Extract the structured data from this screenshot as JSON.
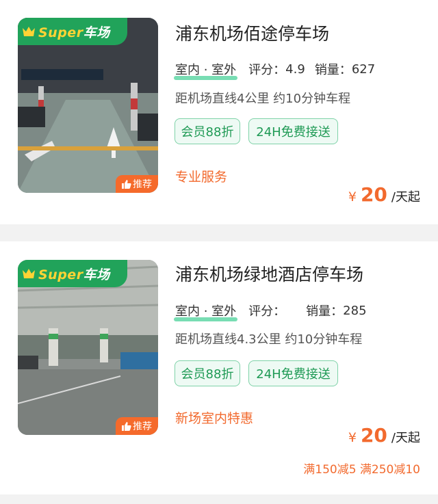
{
  "listings": [
    {
      "name": "浦东机场佰途停车场",
      "badge": "Super车场",
      "badge_prefix": "Super",
      "badge_suffix": "车场",
      "recommend": "推荐",
      "location_type": "室内 · 室外",
      "rating_label": "评分：",
      "rating_value": "4.9",
      "sales_label": "销量：",
      "sales_value": "627",
      "distance": "距机场直线4公里 约10分钟车程",
      "tags": [
        "会员88折",
        "24H免费接送"
      ],
      "feature": "专业服务",
      "currency": "¥",
      "price": "20",
      "price_unit": "/天起"
    },
    {
      "name": "浦东机场绿地酒店停车场",
      "badge": "Super车场",
      "badge_prefix": "Super",
      "badge_suffix": "车场",
      "recommend": "推荐",
      "location_type": "室内 · 室外",
      "rating_label": "评分：",
      "rating_value": "",
      "sales_label": "销量：",
      "sales_value": "285",
      "distance": "距机场直线4.3公里 约10分钟车程",
      "tags": [
        "会员88折",
        "24H免费接送"
      ],
      "feature": "新场室内特惠",
      "currency": "¥",
      "price": "20",
      "price_unit": "/天起",
      "promo": "满150减5 满250减10"
    }
  ],
  "colors": {
    "brand_green": "#21a35a",
    "accent_orange": "#f26a2e",
    "tag_green": "#1f9a55"
  }
}
